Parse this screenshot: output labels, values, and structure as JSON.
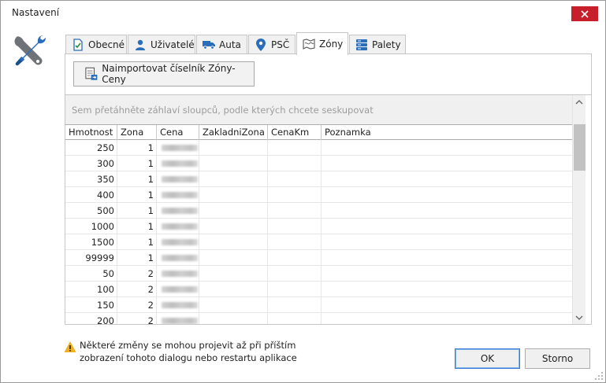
{
  "window": {
    "title": "Nastavení"
  },
  "tabs": [
    {
      "label": "Obecné",
      "icon": "document-check-icon"
    },
    {
      "label": "Uživatelé",
      "icon": "user-icon"
    },
    {
      "label": "Auta",
      "icon": "truck-icon"
    },
    {
      "label": "PSČ",
      "icon": "map-pin-icon"
    },
    {
      "label": "Zóny",
      "icon": "map-icon",
      "active": true
    },
    {
      "label": "Palety",
      "icon": "server-icon"
    }
  ],
  "toolbar": {
    "import_label": "Naimportovat číselník Zóny-Ceny"
  },
  "grid": {
    "group_hint": "Sem přetáhněte záhlaví sloupců, podle kterých chcete seskupovat",
    "columns": [
      "Hmotnost",
      "Zona",
      "Cena",
      "ZakladniZona",
      "CenaKm",
      "Poznamka"
    ],
    "rows": [
      {
        "hmotnost": "250",
        "zona": "1"
      },
      {
        "hmotnost": "300",
        "zona": "1"
      },
      {
        "hmotnost": "350",
        "zona": "1"
      },
      {
        "hmotnost": "400",
        "zona": "1"
      },
      {
        "hmotnost": "500",
        "zona": "1"
      },
      {
        "hmotnost": "1000",
        "zona": "1"
      },
      {
        "hmotnost": "1500",
        "zona": "1"
      },
      {
        "hmotnost": "99999",
        "zona": "1"
      },
      {
        "hmotnost": "50",
        "zona": "2"
      },
      {
        "hmotnost": "100",
        "zona": "2"
      },
      {
        "hmotnost": "150",
        "zona": "2"
      },
      {
        "hmotnost": "200",
        "zona": "2"
      }
    ]
  },
  "footer": {
    "warning_line1": "Některé změny se mohou projevit až při příštím",
    "warning_line2": "zobrazení tohoto dialogu nebo restartu aplikace",
    "ok_label": "OK",
    "cancel_label": "Storno"
  },
  "colors": {
    "accent": "#3c7fd6",
    "close": "#c8202a",
    "tab_icon_blue": "#2a6ebb",
    "warning": "#f2b01e"
  }
}
